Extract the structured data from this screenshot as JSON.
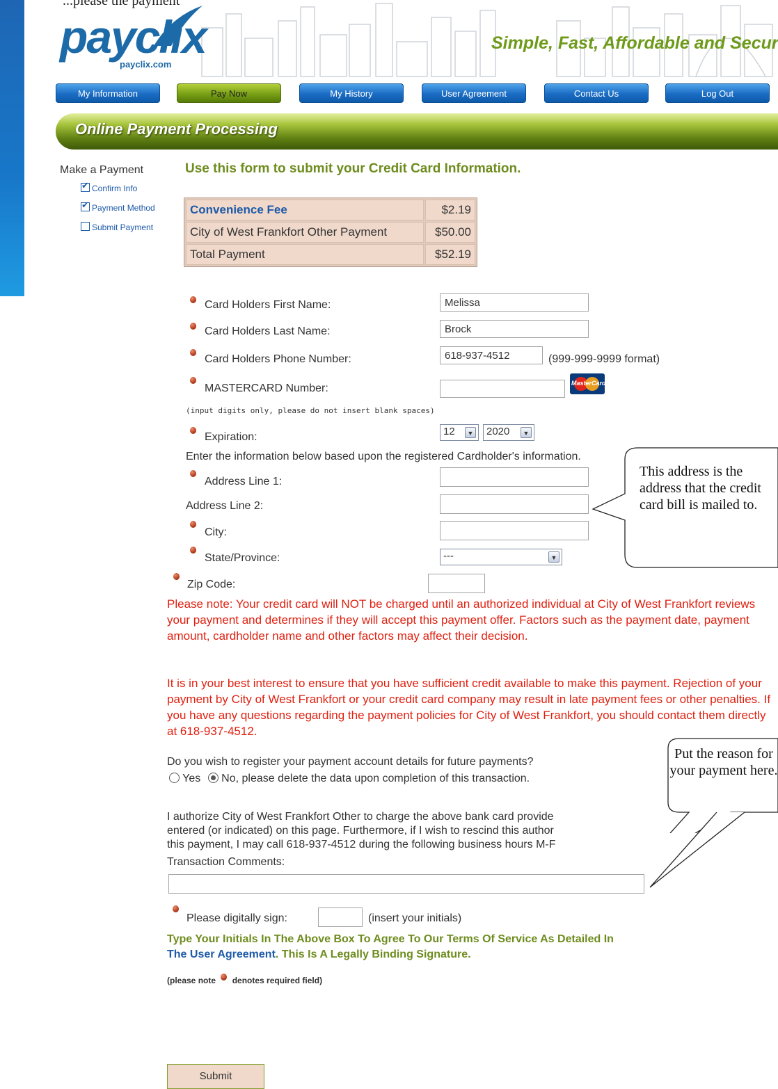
{
  "page": {
    "top_fragment": "...please the payment"
  },
  "header": {
    "logo_text": "payclix",
    "logo_subtext": "payclix.com",
    "slogan": "Simple, Fast, Affordable and Secure."
  },
  "nav": {
    "items": [
      {
        "label": "My Information"
      },
      {
        "label": "Pay Now"
      },
      {
        "label": "My History"
      },
      {
        "label": "User Agreement"
      },
      {
        "label": "Contact Us"
      },
      {
        "label": "Log Out"
      }
    ],
    "active": "Pay Now"
  },
  "section": {
    "title": "Online Payment Processing"
  },
  "sidebar": {
    "title": "Make a Payment",
    "steps": [
      {
        "label": "Confirm Info",
        "checked": true
      },
      {
        "label": "Payment Method",
        "checked": true
      },
      {
        "label": "Submit Payment",
        "checked": false
      }
    ]
  },
  "form": {
    "title": "Use this form to submit your Credit Card Information.",
    "fees": [
      {
        "label": "Convenience Fee",
        "value": "$2.19"
      },
      {
        "label": "City of West Frankfort Other Payment",
        "value": "$50.00"
      },
      {
        "label": "Total Payment",
        "value": "$52.19"
      }
    ],
    "first_name": {
      "label": "Card Holders First Name:",
      "value": "Melissa"
    },
    "last_name": {
      "label": "Card Holders Last Name:",
      "value": "Brock"
    },
    "phone": {
      "label": "Card Holders Phone Number:",
      "value": "618-937-4512",
      "hint": "(999-999-9999 format)"
    },
    "card": {
      "label": "MASTERCARD Number:",
      "value": "",
      "hint": "(input digits only, please do not insert blank spaces)",
      "card_brand": "MasterCard"
    },
    "expiration": {
      "label": "Expiration:",
      "month": "12",
      "year": "2020"
    },
    "address_intro": "Enter the information below based upon the registered Cardholder's information.",
    "address1": {
      "label": "Address Line 1:",
      "value": ""
    },
    "address2": {
      "label": "Address Line 2:",
      "value": ""
    },
    "city": {
      "label": "City:",
      "value": ""
    },
    "state": {
      "label": "State/Province:",
      "value": "---"
    },
    "zip": {
      "label": "Zip Code:",
      "value": ""
    },
    "note1": "Please note: Your credit card will NOT be charged until an authorized individual at City of West Frankfort reviews your payment and determines if they will accept this payment offer. Factors such as the payment date, payment amount, cardholder name and other factors may affect their decision.",
    "note2": "It is in your best interest to ensure that you have sufficient credit available to make this payment. Rejection of your payment by City of West Frankfort or your credit card company may result in late payment fees or other penalties. If you have any questions regarding the payment policies for City of West Frankfort, you should contact them directly at 618-937-4512.",
    "register_question": "Do you wish to register your payment account details for future payments?",
    "register_yes": "Yes",
    "register_no": "No, please delete the data upon completion of this transaction.",
    "register_selected": "no",
    "authorize_line1": "I authorize City of West Frankfort Other to charge the above bank card provide",
    "authorize_line2": "entered (or indicated) on this page. Furthermore, if I wish to rescind this author",
    "authorize_line3": "this payment, I may call 618-937-4512 during the following business hours M-F",
    "comments_label": "Transaction Comments:",
    "comments_value": "",
    "sign_label": "Please digitally sign:",
    "sign_value": "",
    "sign_hint": "(insert your initials)",
    "agree_pre": "Type Your Initials In The Above Box To Agree To Our Terms Of Service As Detailed In",
    "agree_link": "The User Agreement",
    "agree_post": ". This Is A Legally Binding Signature.",
    "required_note_pre": "(please note",
    "required_note_post": "denotes required field)",
    "submit_label": "Submit"
  },
  "callouts": {
    "address": "This address is the address that the credit card bill is mailed to.",
    "reason": "Put the reason for your payment here."
  },
  "colors": {
    "accent_green": "#6e8c1e",
    "nav_blue": "#1a6cc4",
    "note_red": "#e02010",
    "table_bg": "#f0d9cb"
  }
}
